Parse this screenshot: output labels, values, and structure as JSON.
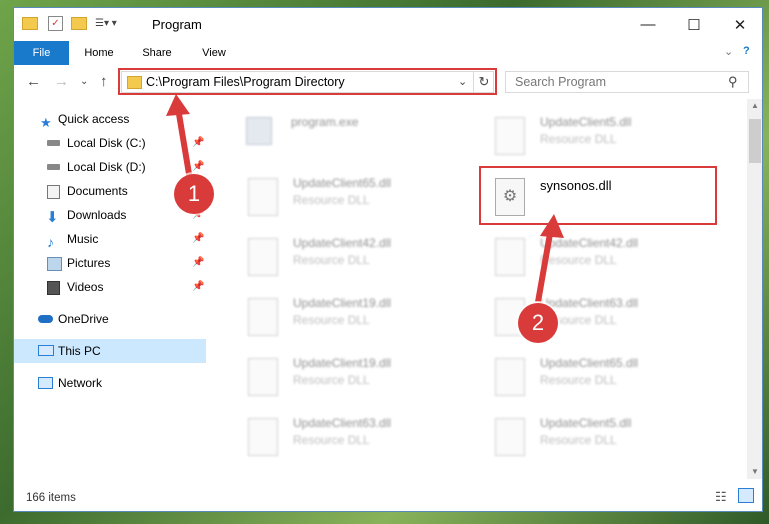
{
  "window": {
    "title": "Program"
  },
  "ribbon": {
    "tabs": [
      "File",
      "Home",
      "Share",
      "View"
    ]
  },
  "address": {
    "path": "C:\\Program Files\\Program Directory"
  },
  "search": {
    "placeholder": "Search Program"
  },
  "nav": {
    "quick_access": "Quick access",
    "items": [
      {
        "label": "Local Disk (C:)",
        "icon": "drive-icon",
        "pinned": true
      },
      {
        "label": "Local Disk (D:)",
        "icon": "drive-icon",
        "pinned": true
      },
      {
        "label": "Documents",
        "icon": "documents-icon",
        "pinned": true
      },
      {
        "label": "Downloads",
        "icon": "downloads-icon",
        "pinned": true
      },
      {
        "label": "Music",
        "icon": "music-icon",
        "pinned": true
      },
      {
        "label": "Pictures",
        "icon": "pictures-icon",
        "pinned": true
      },
      {
        "label": "Videos",
        "icon": "videos-icon",
        "pinned": true
      }
    ],
    "onedrive": "OneDrive",
    "this_pc": "This PC",
    "network": "Network"
  },
  "files": [
    {
      "name": "program.exe",
      "type": ""
    },
    {
      "name": "UpdateClient5.dll",
      "type": "Resource DLL"
    },
    {
      "name": "UpdateClient65.dll",
      "type": "Resource DLL"
    },
    {
      "name": "synsonos.dll",
      "type": ""
    },
    {
      "name": "UpdateClient42.dll",
      "type": "Resource DLL"
    },
    {
      "name": "UpdateClient42.dll",
      "type": "Resource DLL"
    },
    {
      "name": "UpdateClient19.dll",
      "type": "Resource DLL"
    },
    {
      "name": "UpdateClient63.dll",
      "type": "Resource DLL"
    },
    {
      "name": "UpdateClient19.dll",
      "type": "Resource DLL"
    },
    {
      "name": "UpdateClient65.dll",
      "type": "Resource DLL"
    },
    {
      "name": "UpdateClient63.dll",
      "type": "Resource DLL"
    },
    {
      "name": "UpdateClient5.dll",
      "type": "Resource DLL"
    }
  ],
  "status": {
    "count": "166 items"
  },
  "annotations": {
    "marker1": "1",
    "marker2": "2"
  },
  "colors": {
    "accent": "#1979ca",
    "highlight": "#d93a3a",
    "selected": "#cce8ff"
  }
}
